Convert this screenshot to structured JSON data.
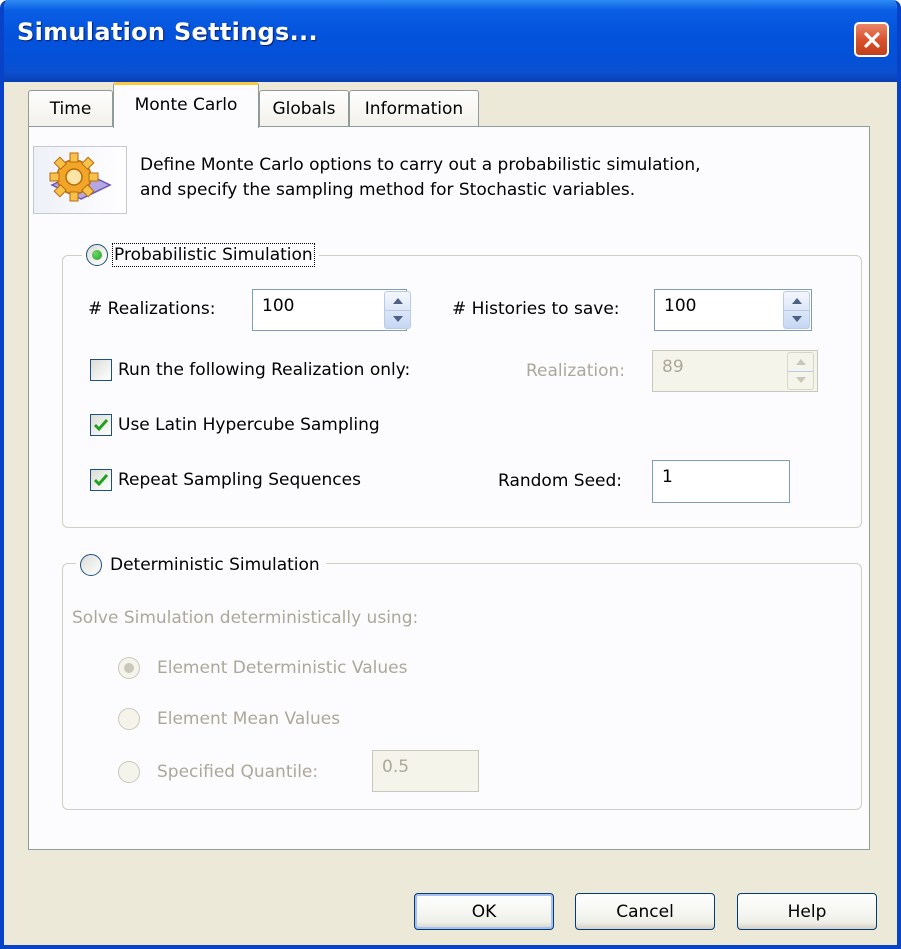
{
  "window": {
    "title": "Simulation Settings..."
  },
  "tabs": [
    {
      "label": "Time"
    },
    {
      "label": "Monte Carlo"
    },
    {
      "label": "Globals"
    },
    {
      "label": "Information"
    }
  ],
  "info": {
    "text": "Define Monte Carlo options to carry out a probabilistic simulation,\nand specify the sampling method for Stochastic variables."
  },
  "probabilistic": {
    "label": "Probabilistic Simulation",
    "realizations_label": "# Realizations:",
    "realizations_value": "100",
    "histories_label": "# Histories to save:",
    "histories_value": "100",
    "run_only_label": "Run the following Realization only:",
    "realization_label": "Realization:",
    "realization_value": "89",
    "lhs_label": "Use Latin Hypercube Sampling",
    "repeat_label": "Repeat Sampling Sequences",
    "seed_label": "Random Seed:",
    "seed_value": "1"
  },
  "deterministic": {
    "label": "Deterministic Simulation",
    "solve_label": "Solve Simulation deterministically using:",
    "opt_values": "Element Deterministic Values",
    "opt_mean": "Element Mean Values",
    "opt_quantile": "Specified Quantile:",
    "quantile_value": "0.5"
  },
  "buttons": {
    "ok": "OK",
    "cancel": "Cancel",
    "help": "Help"
  }
}
